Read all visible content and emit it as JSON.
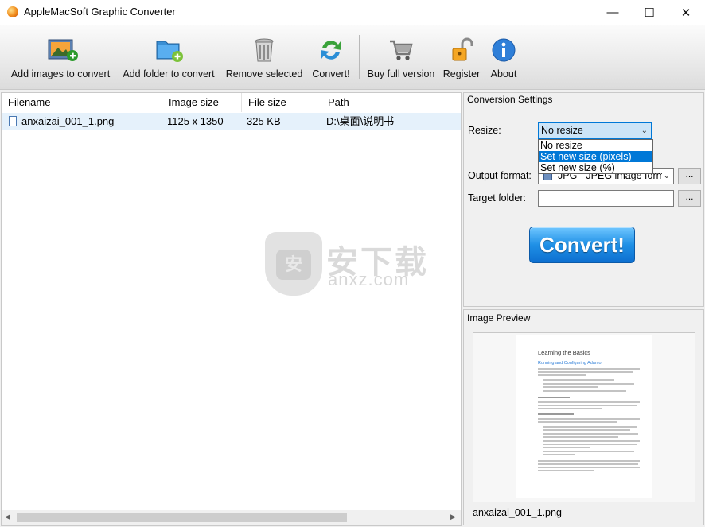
{
  "window": {
    "title": "AppleMacSoft Graphic Converter",
    "minimize": "—",
    "maximize": "☐",
    "close": "✕"
  },
  "toolbar": {
    "add_images": "Add images to convert",
    "add_folder": "Add folder to convert",
    "remove_selected": "Remove selected",
    "convert": "Convert!",
    "buy": "Buy full version",
    "register": "Register",
    "about": "About"
  },
  "file_list": {
    "columns": [
      "Filename",
      "Image size",
      "File size",
      "Path"
    ],
    "rows": [
      {
        "filename": "anxaizai_001_1.png",
        "image_size": "1125 x 1350",
        "file_size": "325 KB",
        "path": "D:\\桌面\\说明书"
      }
    ]
  },
  "watermark": {
    "text": "安下载",
    "sub": "anxz.com",
    "badge": "安"
  },
  "settings": {
    "title": "Conversion Settings",
    "resize_label": "Resize:",
    "resize_value": "No resize",
    "resize_options": [
      "No resize",
      "Set new size (pixels)",
      "Set new size (%)"
    ],
    "output_format_label": "Output format:",
    "output_format_value": "JPG - JPEG image form",
    "target_folder_label": "Target folder:",
    "target_folder_value": "",
    "browse": "...",
    "convert_button": "Convert!"
  },
  "preview": {
    "title": "Image Preview",
    "filename": "anxaizai_001_1.png",
    "doc_title": "Learning the Basics",
    "doc_heading": "Running and Configuring Adamo"
  },
  "colors": {
    "selection": "#0078d7",
    "convert_button": "#1f90e6",
    "row_highlight": "#e5f1fb"
  }
}
